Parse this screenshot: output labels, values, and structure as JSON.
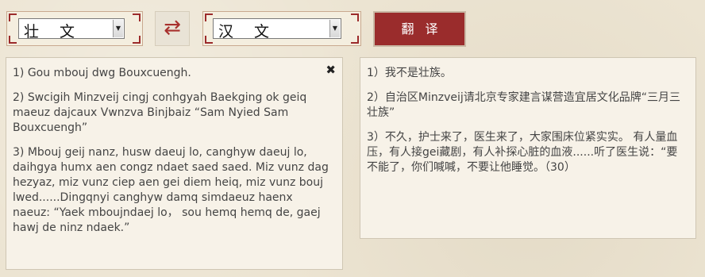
{
  "toolbar": {
    "source_language": "壮  文",
    "target_language": "汉  文",
    "dropdown_arrow": "▼",
    "swap_icon": "⇄",
    "translate_label": "翻译"
  },
  "source_panel": {
    "clear_icon": "✖",
    "paragraphs": [
      "1) Gou mbouj dwg Bouxcuengh.",
      "2) Swcigih Minzveij cingj conhgyah Baekging ok geiq maeuz dajcaux Vwnzva Binjbaiz “Sam Nyied Sam Bouxcuengh”",
      "3) Mbouj geij nanz, husw daeuj lo, canghyw daeuj lo, daihgya humx aen congz ndaet saed saed. Miz vunz dag hezyaz, miz vunz ciep aen gei diem heiq, miz vunz bouj lwed......Dingqnyi canghyw damq simdaeuz haenx naeuz: “Yaek mboujndaej lo， sou hemq hemq de, gaej hawj de ninz ndaek.”"
    ]
  },
  "target_panel": {
    "paragraphs": [
      "1）我不是壮族。",
      "2）自治区Minzveij请北京专家建言谋营造宜居文化品牌“三月三壮族”",
      "3）不久，护士来了，医生来了，大家围床位紧实实。 有人量血压，有人接gei藏剧，有人补探心脏的血液......听了医生说：“要不能了，你们喊喊，不要让他睡觉。（30）"
    ]
  }
}
